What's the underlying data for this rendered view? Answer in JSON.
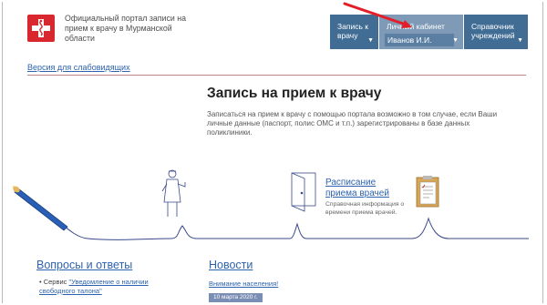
{
  "header": {
    "brand_text": "Официальный портал записи на прием к врачу в Мурманской области"
  },
  "nav": {
    "items": [
      {
        "label": "Запись к врачу"
      },
      {
        "label": "Личный кабинет",
        "user": "Иванов И.И."
      },
      {
        "label": "Справочник учреждений"
      }
    ]
  },
  "accessible_link": "Версия для слабовидящих",
  "main": {
    "title": "Запись на прием к врачу",
    "intro": "Записаться на прием к врачу с помощью портала возможно в том случае, если Ваши личные данные (паспорт, полис ОМС и т.п.) зарегистрированы в базе данных поликлиники."
  },
  "schedule": {
    "title": "Расписание приема врачей",
    "description": "Справочная информация о времени приема врачей."
  },
  "faq": {
    "title": "Вопросы и ответы",
    "item_prefix": "Сервис ",
    "item_link": "\"Уведомление о наличии свободного талона\""
  },
  "news": {
    "title": "Новости",
    "item": "Внимание населения!",
    "date": "10 марта 2020 г."
  },
  "colors": {
    "nav_blue": "#416d95",
    "nav_active": "#7e9ab6",
    "link": "#2d63ae",
    "logo_red": "#d9272f",
    "arrow_red": "#e41e26"
  }
}
